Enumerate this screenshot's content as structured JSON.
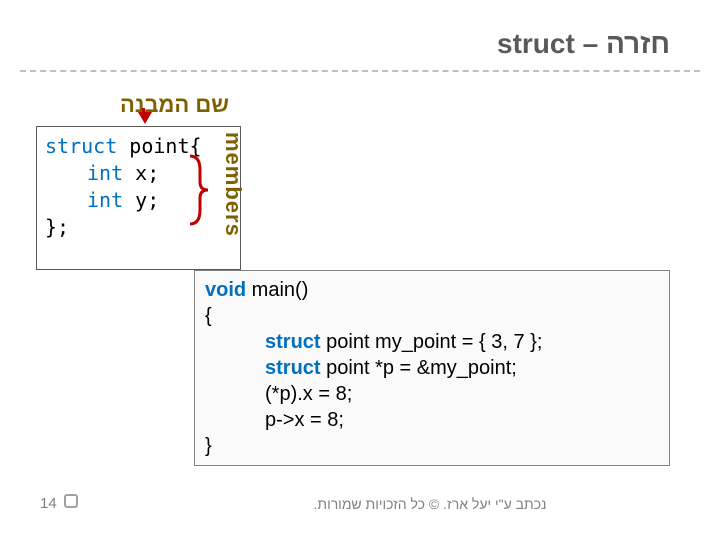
{
  "title": {
    "text": "חזרה – struct"
  },
  "struct_name_label": "שם המבנה",
  "struct_code": {
    "line1_kw": "struct",
    "line1_rest": " point{",
    "line2_kw": "int",
    "line2_rest": " x;",
    "line3_kw": "int",
    "line3_rest": " y;",
    "line4": "};"
  },
  "members_label": "members",
  "main_code": {
    "l1a": "void",
    "l1b": " main()",
    "l2": "{",
    "l3a": "struct",
    "l3b": " point my_point = { 3, 7 };",
    "l4a": "struct",
    "l4b": " point *p = &my_point;",
    "l5": "(*p).x = 8;",
    "l6": "p->x = 8;",
    "l7": "}"
  },
  "page_number": "14",
  "copyright": "נכתב ע\"י יעל ארז. © כל הזכויות שמורות."
}
